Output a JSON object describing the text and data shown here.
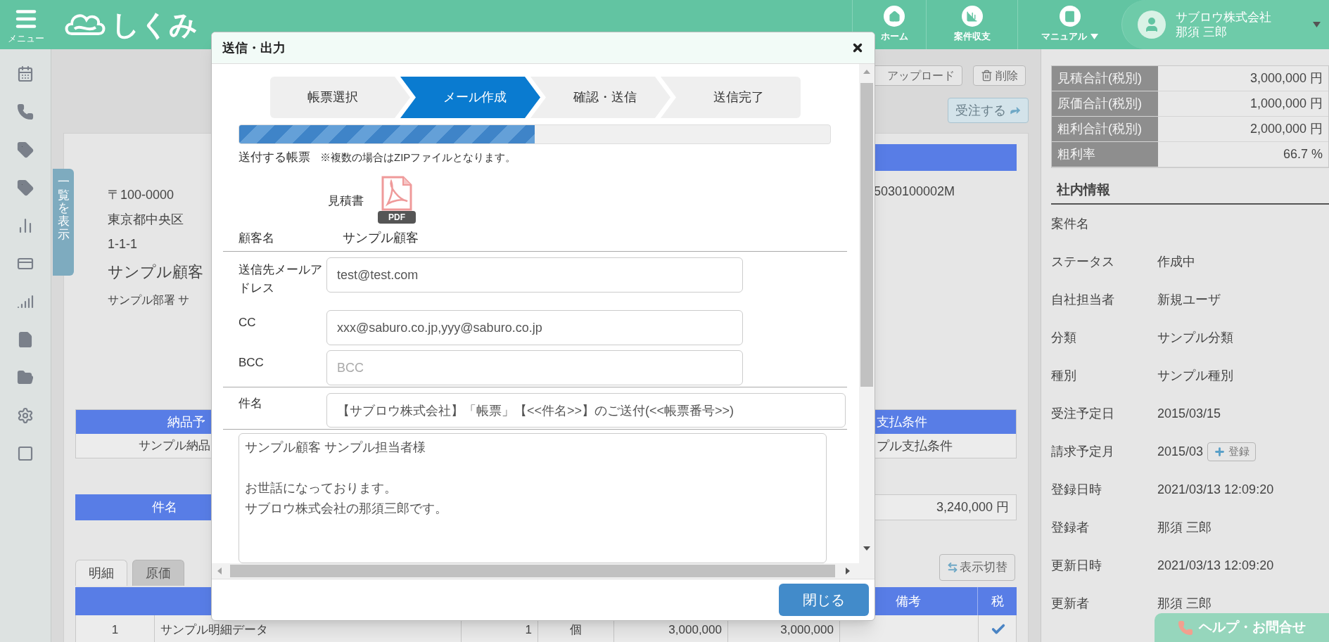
{
  "header": {
    "menu_label": "メニュー",
    "logo": "しくみ",
    "nav": [
      {
        "label": "ホーム",
        "kind": "home",
        "dropdown": false
      },
      {
        "label": "案件収支",
        "kind": "chart",
        "dropdown": false
      },
      {
        "label": "マニュアル",
        "kind": "book",
        "dropdown": true
      }
    ],
    "user": {
      "company": "サブロウ株式会社",
      "name": "那須 三郎",
      "dropdown": true
    }
  },
  "sidebar": {
    "items": [
      {
        "kind": "calendar"
      },
      {
        "kind": "phone"
      },
      {
        "kind": "tag"
      },
      {
        "kind": "tag"
      },
      {
        "kind": "chart"
      },
      {
        "kind": "card"
      },
      {
        "kind": "signal"
      },
      {
        "kind": "file"
      },
      {
        "kind": "folder"
      },
      {
        "kind": "settings"
      },
      {
        "kind": "checkbox"
      }
    ]
  },
  "side_tab": "一覧を表示",
  "toolbar": {
    "buttons": [
      {
        "label": "アップロード",
        "kind": "upload"
      },
      {
        "label": "削除",
        "kind": "delete"
      }
    ],
    "order_button": "受注する"
  },
  "detail": {
    "code": "5030100002M",
    "address": [
      "〒100-0000",
      "東京都中央区",
      "1-1-1"
    ],
    "customer": "サンプル顧客",
    "department": "サンプル部署 サ"
  },
  "terms_table": {
    "headers": [
      "納品予",
      "支払条件"
    ],
    "values": [
      "サンプル納品",
      "プル支払条件"
    ]
  },
  "subject_row": {
    "header": "件名",
    "total": "3,240,000 円"
  },
  "tabs": [
    {
      "label": "明細",
      "selected": true
    },
    {
      "label": "原価",
      "selected": false
    }
  ],
  "toggle_button": "表示切替",
  "items_table": {
    "headers": [
      "備考",
      "税"
    ],
    "rows": [
      {
        "no": "1",
        "name": "サンプル明細データ",
        "qty": "1",
        "unit": "個",
        "price": "3,000,000",
        "amount": "3,000,000",
        "taxed": true
      }
    ]
  },
  "summary": [
    {
      "label": "見積合計(税別)",
      "value": "3,000,000 円"
    },
    {
      "label": "原価合計(税別)",
      "value": "1,000,000 円"
    },
    {
      "label": "粗利合計(税別)",
      "value": "2,000,000 円"
    },
    {
      "label": "粗利率",
      "value": "66.7 %"
    }
  ],
  "internal": {
    "title": "社内情報",
    "fields": [
      {
        "label": "案件名"
      },
      {
        "label": "ステータス",
        "value": "作成中"
      },
      {
        "label": "自社担当者",
        "value": "新規ユーザ"
      },
      {
        "label": "分類",
        "value": "サンプル分類"
      },
      {
        "label": "種別",
        "value": "サンプル種別"
      },
      {
        "label": "受注予定日",
        "value": "2015/03/15"
      },
      {
        "label": "請求予定月",
        "value": "2015/03",
        "button": "登録"
      },
      {
        "label": "登録日時",
        "value": "2021/03/13 12:09:20"
      },
      {
        "label": "登録者",
        "value": "那須 三郎"
      },
      {
        "label": "更新日時",
        "value": "2021/03/13 12:09:20"
      },
      {
        "label": "更新者",
        "value": "那須 三郎"
      }
    ]
  },
  "help_button": "ヘルプ・お問合せ",
  "dialog": {
    "title": "送信・出力",
    "steps": [
      {
        "label": "帳票選択",
        "selected": false
      },
      {
        "label": "メール作成",
        "selected": true
      },
      {
        "label": "確認・送信",
        "selected": false
      },
      {
        "label": "送信完了",
        "selected": false
      }
    ],
    "progress": {
      "level": 0.5
    },
    "attachments_label": "送付する帳票",
    "attachments_note": "※複数の場合はZIPファイルとなります。",
    "document": {
      "name": "見積書",
      "file_type": "PDF"
    },
    "customer_label": "顧客名",
    "customer": "サンプル顧客",
    "fields": [
      {
        "label": "送信先メールアドレス",
        "value": "test@test.com"
      },
      {
        "label": "CC",
        "value": "xxx@saburo.co.jp,yyy@saburo.co.jp"
      },
      {
        "label": "BCC",
        "placeholder": "BCC"
      }
    ],
    "subject": {
      "label": "件名",
      "value": "【サブロウ株式会社】「帳票」【<<件名>>】のご送付(<<帳票番号>>)"
    },
    "body": [
      [
        "サンプル顧客 サンプル担当者様"
      ],
      [
        "お世話になっております。",
        "サブロウ株式会社の那須三郎です。"
      ]
    ],
    "close_button": "閉じる"
  }
}
